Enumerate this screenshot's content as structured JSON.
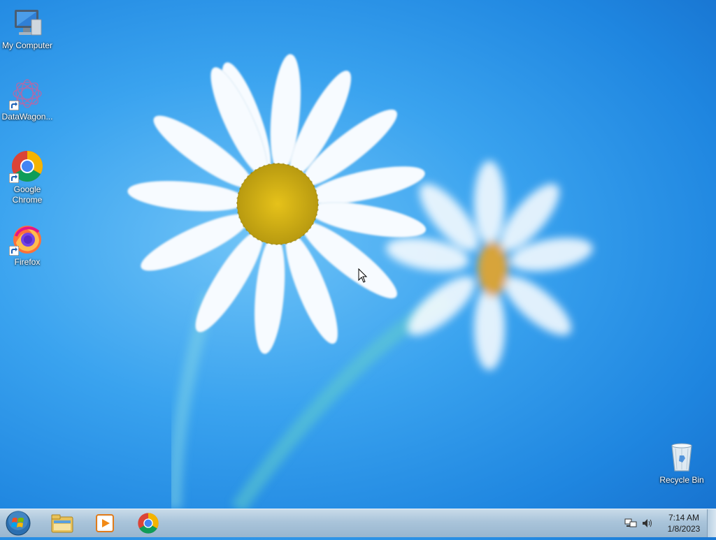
{
  "desktop": {
    "icons": [
      {
        "label": "My Computer",
        "icon": "my-computer-icon"
      },
      {
        "label": "DataWagon...",
        "icon": "datawagon-icon",
        "shortcut": true
      },
      {
        "label": "Google Chrome",
        "icon": "chrome-icon",
        "shortcut": true
      },
      {
        "label": "Firefox",
        "icon": "firefox-icon",
        "shortcut": true
      },
      {
        "label": "Recycle Bin",
        "icon": "recycle-bin-icon"
      }
    ]
  },
  "taskbar": {
    "start": {
      "icon": "windows-start-icon"
    },
    "pinned": [
      {
        "icon": "file-explorer-icon"
      },
      {
        "icon": "media-player-icon"
      },
      {
        "icon": "chrome-icon"
      }
    ],
    "tray": {
      "icons": [
        "network-icon",
        "volume-icon"
      ],
      "time": "7:14 AM",
      "date": "1/8/2023"
    }
  },
  "colors": {
    "wallpaper_blue": "#2a93e8",
    "taskbar": "#a9c4da"
  }
}
